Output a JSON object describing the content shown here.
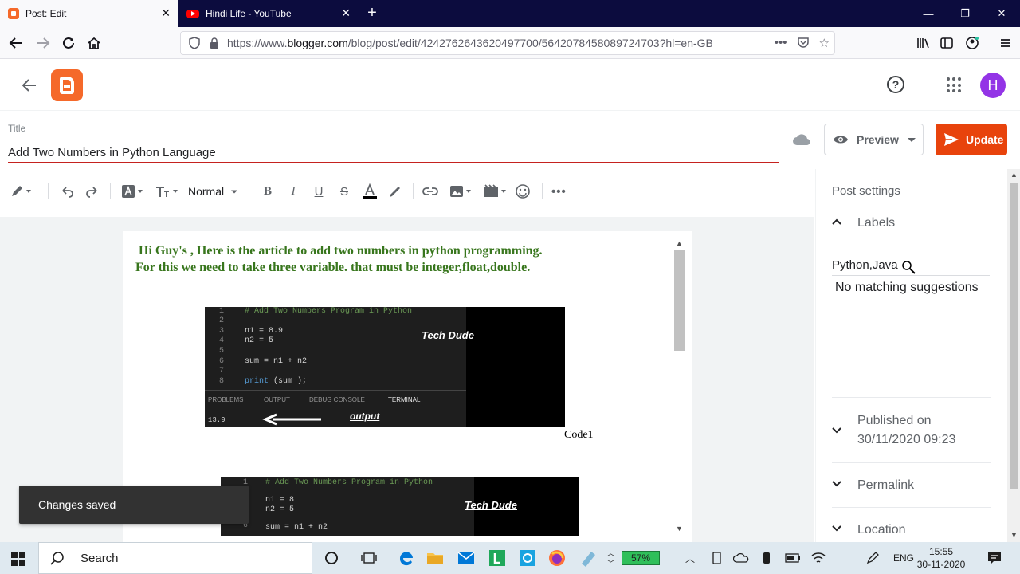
{
  "browser": {
    "tabs": [
      {
        "title": "Post: Edit",
        "active": true
      },
      {
        "title": "Hindi Life - YouTube",
        "active": false
      }
    ],
    "url_prefix": "https://www.",
    "url_domain": "blogger.com",
    "url_path": "/blog/post/edit/4242762643620497700/5642078458089724703?hl=en-GB"
  },
  "blogger": {
    "avatar_initial": "H"
  },
  "post": {
    "title_label": "Title",
    "title_value": "Add Two Numbers in Python Language",
    "preview_label": "Preview",
    "update_label": "Update"
  },
  "toolbar": {
    "format_value": "Normal"
  },
  "editor": {
    "line1": "Hi Guy's , Here is the article to add two numbers in python programming.",
    "line2": "For this we need to take three variable. that must be integer,float,double.",
    "caption1": "Code1",
    "code1": {
      "comment": "# Add Two Numbers Program in Python",
      "line3": "n1 = 8.9",
      "line4": "n2 = 5",
      "line6": "sum = n1 + n2",
      "line8_kw": "print",
      "line8_rest": " (sum );",
      "brand": "Tech Dude",
      "panel_tabs": [
        "PROBLEMS",
        "OUTPUT",
        "DEBUG CONSOLE",
        "TERMINAL"
      ],
      "result": "13.9",
      "output_label": "output"
    },
    "code2": {
      "comment": "# Add Two Numbers Program in Python",
      "line3": "n1 = 8",
      "line4": "n2 = 5",
      "line6": "sum = n1 + n2",
      "brand": "Tech Dude"
    }
  },
  "snackbar": {
    "message": "Changes saved"
  },
  "sidebar": {
    "title": "Post settings",
    "labels_heading": "Labels",
    "labels_value": "Python,Java",
    "no_match": "No matching suggestions",
    "published_heading": "Published on",
    "published_value": "30/11/2020 09:23",
    "permalink_heading": "Permalink",
    "location_heading": "Location"
  },
  "taskbar": {
    "search_label": "Search",
    "battery": "57%",
    "language": "ENG",
    "time": "15:55",
    "date": "30-11-2020"
  },
  "colors": {
    "blogger_orange": "#f5692a",
    "update_button": "#e8430c",
    "editor_text_green": "#38761d",
    "avatar_purple": "#9334e6"
  }
}
